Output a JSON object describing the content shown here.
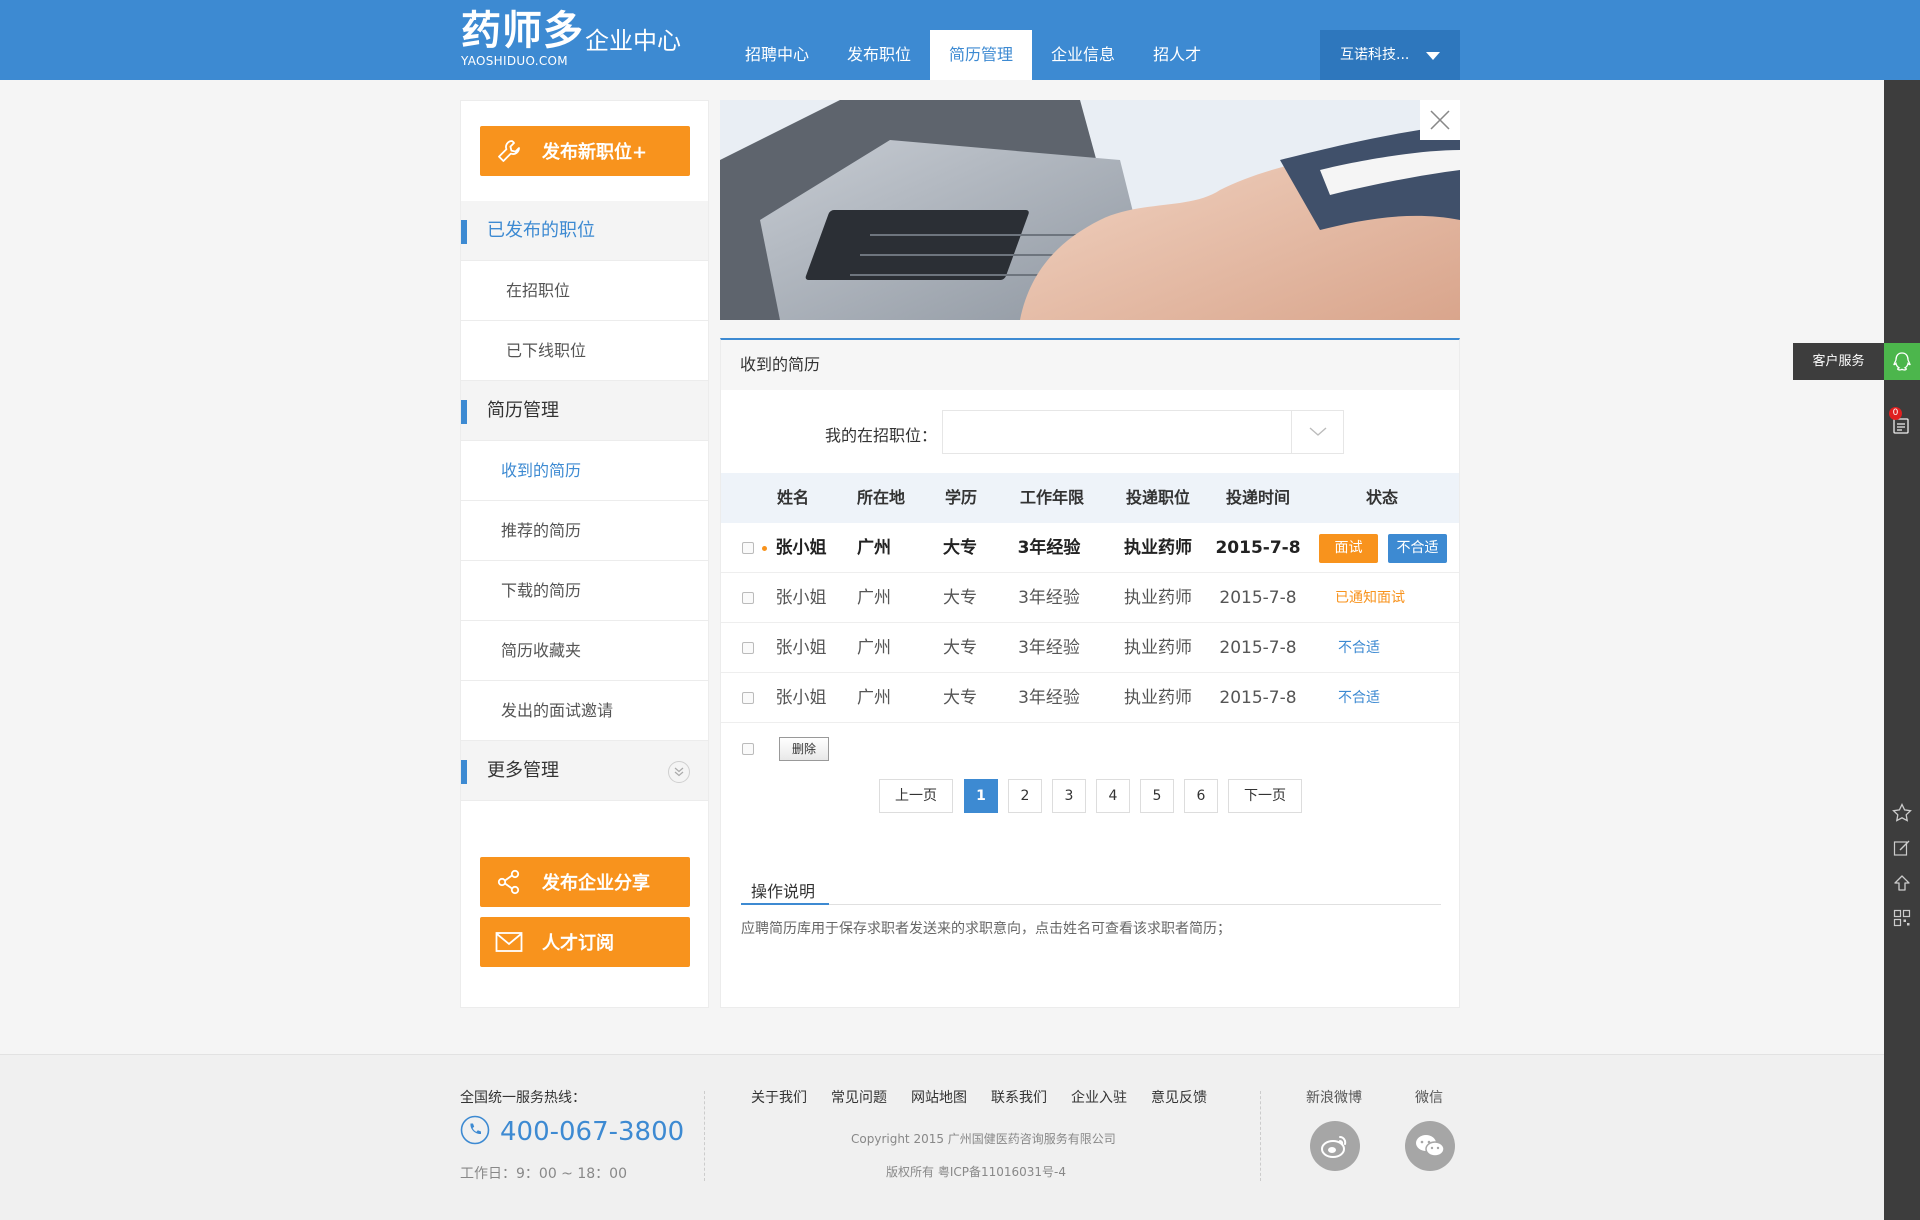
{
  "header": {
    "logo_cn": "药师多",
    "logo_en": "YAOSHIDUO.COM",
    "subtitle": "企业中心",
    "nav": [
      "招聘中心",
      "发布职位",
      "简历管理",
      "企业信息",
      "招人才"
    ],
    "active_nav": "简历管理",
    "user": "互诺科技..."
  },
  "sidebar": {
    "publish_button": "发布新职位+",
    "section_jobs": "已发布的职位",
    "jobs_items": [
      "在招职位",
      "已下线职位"
    ],
    "section_resume": "简历管理",
    "resume_items": [
      "收到的简历",
      "推荐的简历",
      "下载的简历",
      "简历收藏夹",
      "发出的面试邀请"
    ],
    "section_more": "更多管理",
    "share_button": "发布企业分享",
    "subscribe_button": "人才订阅"
  },
  "main": {
    "panel_title": "收到的简历",
    "filter_label": "我的在招职位：",
    "filter_value": "",
    "columns": [
      "姓名",
      "所在地",
      "学历",
      "工作年限",
      "投递职位",
      "投递时间",
      "状态"
    ],
    "rows": [
      {
        "name": "张小姐",
        "location": "广州",
        "education": "大专",
        "experience": "3年经验",
        "position": "执业药师",
        "date": "2015-7-8",
        "status": "",
        "unread": true
      },
      {
        "name": "张小姐",
        "location": "广州",
        "education": "大专",
        "experience": "3年经验",
        "position": "执业药师",
        "date": "2015-7-8",
        "status": "已通知面试",
        "unread": false
      },
      {
        "name": "张小姐",
        "location": "广州",
        "education": "大专",
        "experience": "3年经验",
        "position": "执业药师",
        "date": "2015-7-8",
        "status": "不合适",
        "unread": false
      },
      {
        "name": "张小姐",
        "location": "广州",
        "education": "大专",
        "experience": "3年经验",
        "position": "执业药师",
        "date": "2015-7-8",
        "status": "不合适",
        "unread": false
      }
    ],
    "action_interview": "面试",
    "action_reject": "不合适",
    "delete_label": "删除",
    "pagination": {
      "prev": "上一页",
      "next": "下一页",
      "pages": [
        "1",
        "2",
        "3",
        "4",
        "5",
        "6"
      ],
      "current": "1"
    },
    "howto_title": "操作说明",
    "howto_text": "应聘简历库用于保存求职者发送来的求职意向，点击姓名可查看该求职者简历；"
  },
  "right_bar": {
    "service_label": "客户服务",
    "badge_count": "0"
  },
  "footer": {
    "hotline_label": "全国统一服务热线：",
    "phone": "400-067-3800",
    "hours": "工作日：9：00 ~ 18：00",
    "links": [
      "关于我们",
      "常见问题",
      "网站地图",
      "联系我们",
      "企业入驻",
      "意见反馈"
    ],
    "copyright": "Copyright 2015 广州国健医药咨询服务有限公司",
    "icp": "版权所有    粤ICP备11016031号-4",
    "social": [
      "新浪微博",
      "微信"
    ]
  },
  "colors": {
    "primary": "#3d8ad2",
    "accent": "#f8931d",
    "status_notified": "#f8931d",
    "status_reject": "#3d8ad2"
  }
}
